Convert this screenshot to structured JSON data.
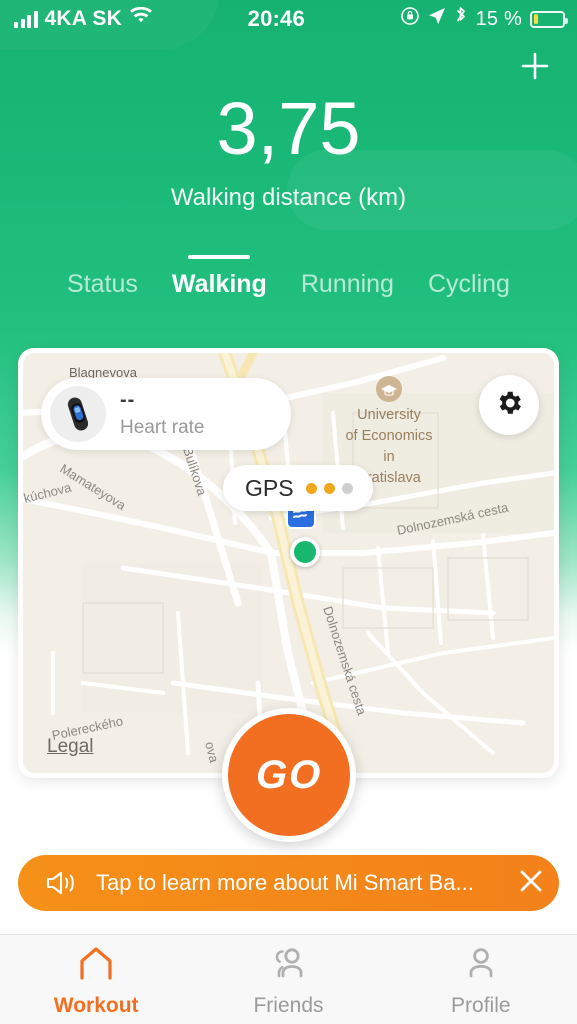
{
  "status_bar": {
    "carrier": "4KA SK",
    "signal_icon": "signal-bars-icon",
    "wifi_icon": "wifi-icon",
    "clock": "20:46",
    "rotation_lock_icon": "rotation-lock-icon",
    "location_icon": "location-arrow-icon",
    "bluetooth_icon": "bluetooth-icon",
    "battery_percent": "15 %",
    "battery_level": 15,
    "battery_color": "#ffd93d"
  },
  "header": {
    "add_icon": "plus-icon",
    "metric_value": "3,75",
    "metric_label": "Walking distance (km)",
    "background_color": "#16b272"
  },
  "tabs": [
    {
      "label": "Status",
      "active": false
    },
    {
      "label": "Walking",
      "active": true
    },
    {
      "label": "Running",
      "active": false
    },
    {
      "label": "Cycling",
      "active": false
    }
  ],
  "map": {
    "heart_rate": {
      "device_icon": "mi-band-device-icon",
      "value": "--",
      "label": "Heart rate"
    },
    "gps": {
      "label": "GPS",
      "dots": [
        "#f2a81d",
        "#f2a81d",
        "#cfcfcf"
      ],
      "strength": 2,
      "total_dots": 3
    },
    "settings_icon": "gear-icon",
    "legal_link": "Legal",
    "marker_icon": "transit-marker-icon",
    "location_dot_color": "#15b86d",
    "poi": {
      "icon": "graduation-cap-icon",
      "lines": [
        "University",
        "of Economics",
        "in",
        "Bratislava"
      ]
    },
    "street_labels": [
      "Blagnevova",
      "Mamateyova",
      "Bulíkova",
      "kúchova",
      "Polereckého",
      "Dolnozemská cesta",
      "Dolnozemská cesta",
      "ova"
    ]
  },
  "go_button": {
    "label": "GO",
    "color": "#f26f21"
  },
  "promo_banner": {
    "icon": "megaphone-icon",
    "text": "Tap to learn more about Mi Smart Ba...",
    "close_icon": "close-icon",
    "color": "#f4811a"
  },
  "bottom_nav": [
    {
      "label": "Workout",
      "icon": "home-icon",
      "active": true
    },
    {
      "label": "Friends",
      "icon": "people-icon",
      "active": false
    },
    {
      "label": "Profile",
      "icon": "person-icon",
      "active": false
    }
  ],
  "accent_color": "#f26f21"
}
